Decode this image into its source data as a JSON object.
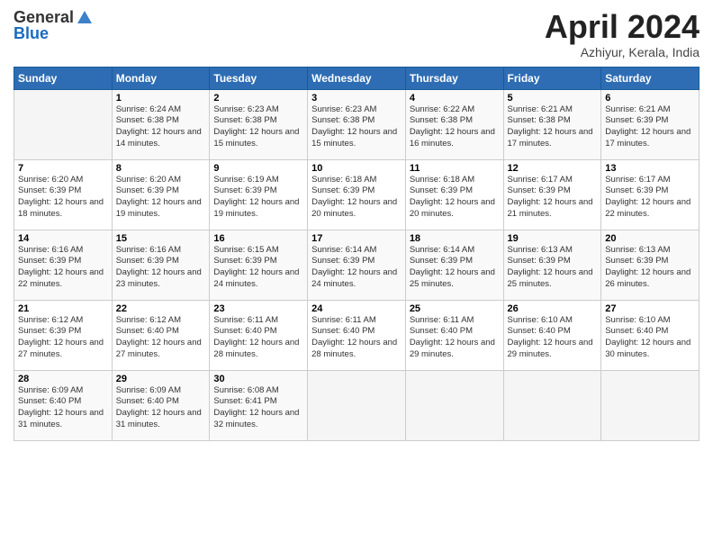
{
  "header": {
    "logo_line1": "General",
    "logo_line2": "Blue",
    "month_title": "April 2024",
    "location": "Azhiyur, Kerala, India"
  },
  "days_of_week": [
    "Sunday",
    "Monday",
    "Tuesday",
    "Wednesday",
    "Thursday",
    "Friday",
    "Saturday"
  ],
  "weeks": [
    [
      {
        "num": "",
        "sunrise": "",
        "sunset": "",
        "daylight": "",
        "empty": true
      },
      {
        "num": "1",
        "sunrise": "Sunrise: 6:24 AM",
        "sunset": "Sunset: 6:38 PM",
        "daylight": "Daylight: 12 hours and 14 minutes."
      },
      {
        "num": "2",
        "sunrise": "Sunrise: 6:23 AM",
        "sunset": "Sunset: 6:38 PM",
        "daylight": "Daylight: 12 hours and 15 minutes."
      },
      {
        "num": "3",
        "sunrise": "Sunrise: 6:23 AM",
        "sunset": "Sunset: 6:38 PM",
        "daylight": "Daylight: 12 hours and 15 minutes."
      },
      {
        "num": "4",
        "sunrise": "Sunrise: 6:22 AM",
        "sunset": "Sunset: 6:38 PM",
        "daylight": "Daylight: 12 hours and 16 minutes."
      },
      {
        "num": "5",
        "sunrise": "Sunrise: 6:21 AM",
        "sunset": "Sunset: 6:38 PM",
        "daylight": "Daylight: 12 hours and 17 minutes."
      },
      {
        "num": "6",
        "sunrise": "Sunrise: 6:21 AM",
        "sunset": "Sunset: 6:39 PM",
        "daylight": "Daylight: 12 hours and 17 minutes."
      }
    ],
    [
      {
        "num": "7",
        "sunrise": "Sunrise: 6:20 AM",
        "sunset": "Sunset: 6:39 PM",
        "daylight": "Daylight: 12 hours and 18 minutes."
      },
      {
        "num": "8",
        "sunrise": "Sunrise: 6:20 AM",
        "sunset": "Sunset: 6:39 PM",
        "daylight": "Daylight: 12 hours and 19 minutes."
      },
      {
        "num": "9",
        "sunrise": "Sunrise: 6:19 AM",
        "sunset": "Sunset: 6:39 PM",
        "daylight": "Daylight: 12 hours and 19 minutes."
      },
      {
        "num": "10",
        "sunrise": "Sunrise: 6:18 AM",
        "sunset": "Sunset: 6:39 PM",
        "daylight": "Daylight: 12 hours and 20 minutes."
      },
      {
        "num": "11",
        "sunrise": "Sunrise: 6:18 AM",
        "sunset": "Sunset: 6:39 PM",
        "daylight": "Daylight: 12 hours and 20 minutes."
      },
      {
        "num": "12",
        "sunrise": "Sunrise: 6:17 AM",
        "sunset": "Sunset: 6:39 PM",
        "daylight": "Daylight: 12 hours and 21 minutes."
      },
      {
        "num": "13",
        "sunrise": "Sunrise: 6:17 AM",
        "sunset": "Sunset: 6:39 PM",
        "daylight": "Daylight: 12 hours and 22 minutes."
      }
    ],
    [
      {
        "num": "14",
        "sunrise": "Sunrise: 6:16 AM",
        "sunset": "Sunset: 6:39 PM",
        "daylight": "Daylight: 12 hours and 22 minutes."
      },
      {
        "num": "15",
        "sunrise": "Sunrise: 6:16 AM",
        "sunset": "Sunset: 6:39 PM",
        "daylight": "Daylight: 12 hours and 23 minutes."
      },
      {
        "num": "16",
        "sunrise": "Sunrise: 6:15 AM",
        "sunset": "Sunset: 6:39 PM",
        "daylight": "Daylight: 12 hours and 24 minutes."
      },
      {
        "num": "17",
        "sunrise": "Sunrise: 6:14 AM",
        "sunset": "Sunset: 6:39 PM",
        "daylight": "Daylight: 12 hours and 24 minutes."
      },
      {
        "num": "18",
        "sunrise": "Sunrise: 6:14 AM",
        "sunset": "Sunset: 6:39 PM",
        "daylight": "Daylight: 12 hours and 25 minutes."
      },
      {
        "num": "19",
        "sunrise": "Sunrise: 6:13 AM",
        "sunset": "Sunset: 6:39 PM",
        "daylight": "Daylight: 12 hours and 25 minutes."
      },
      {
        "num": "20",
        "sunrise": "Sunrise: 6:13 AM",
        "sunset": "Sunset: 6:39 PM",
        "daylight": "Daylight: 12 hours and 26 minutes."
      }
    ],
    [
      {
        "num": "21",
        "sunrise": "Sunrise: 6:12 AM",
        "sunset": "Sunset: 6:39 PM",
        "daylight": "Daylight: 12 hours and 27 minutes."
      },
      {
        "num": "22",
        "sunrise": "Sunrise: 6:12 AM",
        "sunset": "Sunset: 6:40 PM",
        "daylight": "Daylight: 12 hours and 27 minutes."
      },
      {
        "num": "23",
        "sunrise": "Sunrise: 6:11 AM",
        "sunset": "Sunset: 6:40 PM",
        "daylight": "Daylight: 12 hours and 28 minutes."
      },
      {
        "num": "24",
        "sunrise": "Sunrise: 6:11 AM",
        "sunset": "Sunset: 6:40 PM",
        "daylight": "Daylight: 12 hours and 28 minutes."
      },
      {
        "num": "25",
        "sunrise": "Sunrise: 6:11 AM",
        "sunset": "Sunset: 6:40 PM",
        "daylight": "Daylight: 12 hours and 29 minutes."
      },
      {
        "num": "26",
        "sunrise": "Sunrise: 6:10 AM",
        "sunset": "Sunset: 6:40 PM",
        "daylight": "Daylight: 12 hours and 29 minutes."
      },
      {
        "num": "27",
        "sunrise": "Sunrise: 6:10 AM",
        "sunset": "Sunset: 6:40 PM",
        "daylight": "Daylight: 12 hours and 30 minutes."
      }
    ],
    [
      {
        "num": "28",
        "sunrise": "Sunrise: 6:09 AM",
        "sunset": "Sunset: 6:40 PM",
        "daylight": "Daylight: 12 hours and 31 minutes."
      },
      {
        "num": "29",
        "sunrise": "Sunrise: 6:09 AM",
        "sunset": "Sunset: 6:40 PM",
        "daylight": "Daylight: 12 hours and 31 minutes."
      },
      {
        "num": "30",
        "sunrise": "Sunrise: 6:08 AM",
        "sunset": "Sunset: 6:41 PM",
        "daylight": "Daylight: 12 hours and 32 minutes."
      },
      {
        "num": "",
        "sunrise": "",
        "sunset": "",
        "daylight": "",
        "empty": true
      },
      {
        "num": "",
        "sunrise": "",
        "sunset": "",
        "daylight": "",
        "empty": true
      },
      {
        "num": "",
        "sunrise": "",
        "sunset": "",
        "daylight": "",
        "empty": true
      },
      {
        "num": "",
        "sunrise": "",
        "sunset": "",
        "daylight": "",
        "empty": true
      }
    ]
  ]
}
